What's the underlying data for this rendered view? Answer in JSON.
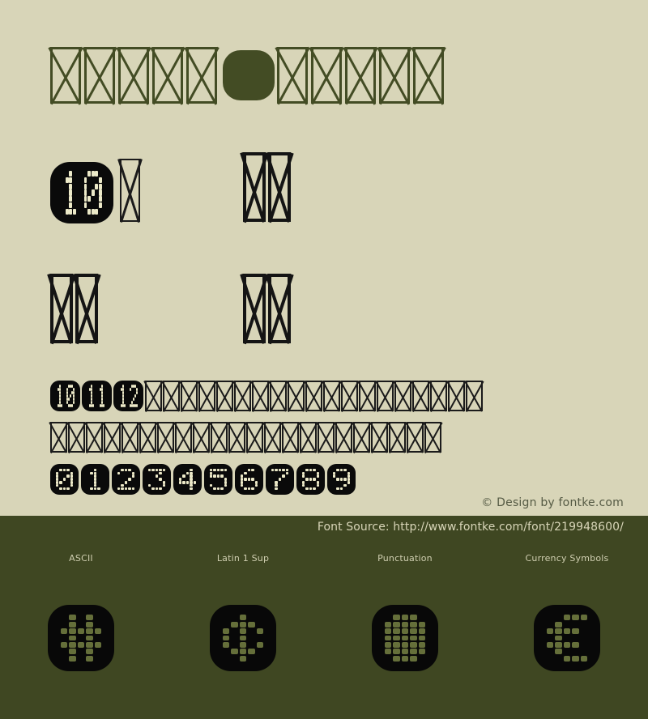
{
  "page": {
    "background_color": "#d8d5b8",
    "footer_color": "#3f4722",
    "accent_color": "#434c24",
    "led_on_color": "#ece9c8",
    "tile_color": "#0a0a0a"
  },
  "title": {
    "glyph_count": 11,
    "note": "font title rendered as missing-glyph boxes",
    "items": [
      {
        "kind": "tofu"
      },
      {
        "kind": "tofu"
      },
      {
        "kind": "tofu"
      },
      {
        "kind": "tofu"
      },
      {
        "kind": "tofu"
      },
      {
        "kind": "solid"
      },
      {
        "kind": "tofu"
      },
      {
        "kind": "tofu"
      },
      {
        "kind": "tofu"
      },
      {
        "kind": "tofu"
      },
      {
        "kind": "tofu"
      }
    ]
  },
  "sample_big": {
    "number_label": "10",
    "tofu_after": 1,
    "group_b_count": 2,
    "group_c_count": 2,
    "group_d_count": 2
  },
  "rows": {
    "numbers_row": {
      "numbers": [
        "10",
        "11",
        "12"
      ],
      "tofu_count": 19
    },
    "tofu_row_2": {
      "tofu_count": 22
    },
    "digits_row": {
      "digits": [
        "0",
        "1",
        "2",
        "3",
        "4",
        "5",
        "6",
        "7",
        "8",
        "9"
      ]
    }
  },
  "credit": {
    "text": "© Design by fontke.com"
  },
  "footer": {
    "font_source_label": "Font Source: http://www.fontke.com/font/219948600/",
    "categories": [
      {
        "label": "ASCII",
        "glyph": "#",
        "icon_name": "hash-glyph"
      },
      {
        "label": "Latin 1 Sup",
        "glyph": "¢",
        "icon_name": "cent-glyph"
      },
      {
        "label": "Punctuation",
        "glyph": "█",
        "icon_name": "block-glyph"
      },
      {
        "label": "Currency Symbols",
        "glyph": "€",
        "icon_name": "euro-glyph"
      }
    ]
  },
  "led_patterns": {
    "0": [
      "01110",
      "10001",
      "10011",
      "10101",
      "11001",
      "10001",
      "01110"
    ],
    "1": [
      "00100",
      "01100",
      "00100",
      "00100",
      "00100",
      "00100",
      "01110"
    ],
    "2": [
      "01110",
      "10001",
      "00001",
      "00010",
      "00100",
      "01000",
      "11111"
    ],
    "3": [
      "11111",
      "00010",
      "00100",
      "00010",
      "00001",
      "10001",
      "01110"
    ],
    "4": [
      "00010",
      "00110",
      "01010",
      "10010",
      "11111",
      "00010",
      "00010"
    ],
    "5": [
      "11111",
      "10000",
      "11110",
      "00001",
      "00001",
      "10001",
      "01110"
    ],
    "6": [
      "00110",
      "01000",
      "10000",
      "11110",
      "10001",
      "10001",
      "01110"
    ],
    "7": [
      "11111",
      "00001",
      "00010",
      "00100",
      "01000",
      "01000",
      "01000"
    ],
    "8": [
      "01110",
      "10001",
      "10001",
      "01110",
      "10001",
      "10001",
      "01110"
    ],
    "9": [
      "01110",
      "10001",
      "10001",
      "01111",
      "00001",
      "00010",
      "01100"
    ],
    "hash": [
      "01010",
      "01010",
      "11111",
      "01010",
      "11111",
      "01010",
      "01010"
    ],
    "cent": [
      "00100",
      "01110",
      "10101",
      "10100",
      "10101",
      "01110",
      "00100"
    ],
    "block": [
      "01110",
      "11111",
      "11111",
      "11111",
      "11111",
      "11111",
      "01110"
    ],
    "euro": [
      "00111",
      "01000",
      "11110",
      "01000",
      "11110",
      "01000",
      "00111"
    ]
  }
}
